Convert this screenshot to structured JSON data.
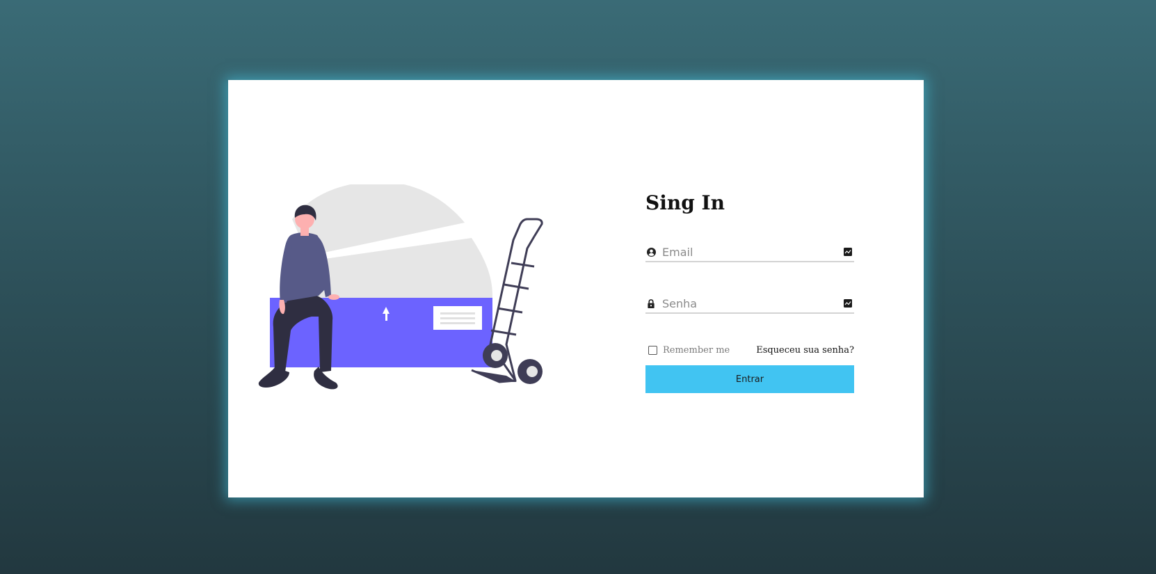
{
  "login": {
    "title": "Sing In",
    "email": {
      "placeholder": "Email",
      "value": "",
      "icon": "user-circle-icon",
      "trail_icon": "autofill-icon"
    },
    "password": {
      "placeholder": "Senha",
      "value": "",
      "icon": "lock-icon",
      "trail_icon": "autofill-icon"
    },
    "remember_label": "Remember me",
    "remember_checked": false,
    "forgot_label": "Esqueceu sua senha?",
    "submit_label": "Entrar"
  },
  "colors": {
    "accent": "#41c4f2",
    "box": "#6c63ff",
    "background_top": "#3a6b76",
    "background_bottom": "#22383f"
  },
  "illustration": {
    "name": "person-sitting-on-box-with-hand-truck"
  }
}
